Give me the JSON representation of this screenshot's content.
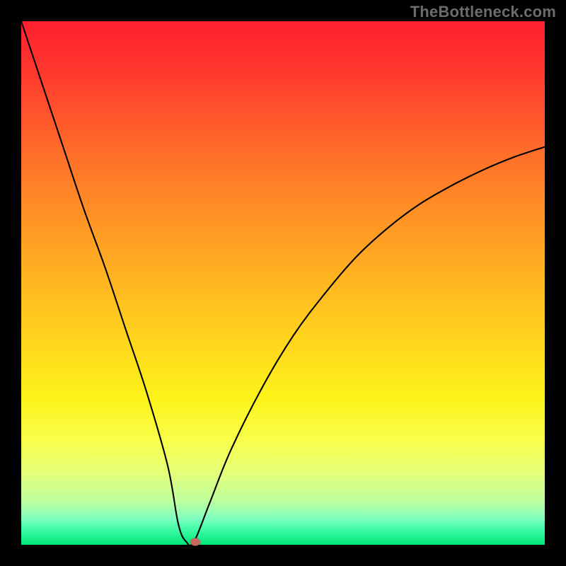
{
  "watermark": "TheBottleneck.com",
  "colors": {
    "frame_bg": "#000000",
    "curve_stroke": "#000000",
    "marker_fill": "#cb675f",
    "gradient_stops": [
      "#ff1f2f",
      "#ff3a2d",
      "#ff6a2a",
      "#ff8f26",
      "#ffb621",
      "#ffd81c",
      "#fcf31a",
      "#f8ff4a",
      "#e6ff78",
      "#baffa0",
      "#7effc0",
      "#35f9a0",
      "#00e676"
    ]
  },
  "chart_data": {
    "type": "line",
    "title": "",
    "xlabel": "",
    "ylabel": "",
    "xlim": [
      0,
      100
    ],
    "ylim": [
      0,
      100
    ],
    "grid": false,
    "legend": false,
    "series": [
      {
        "name": "bottleneck-curve",
        "x": [
          0,
          4,
          8,
          12,
          16,
          20,
          24,
          28,
          30,
          31.5,
          33,
          36,
          40,
          46,
          52,
          58,
          64,
          70,
          76,
          82,
          88,
          94,
          100
        ],
        "y": [
          100,
          88,
          76,
          64,
          53,
          41,
          29,
          15,
          4,
          0.6,
          0.6,
          8,
          18,
          30,
          40,
          48,
          55,
          60.5,
          65,
          68.5,
          71.5,
          74,
          76
        ]
      }
    ],
    "marker": {
      "x": 33.2,
      "y": 0.6
    },
    "notes": "Values are read off a normalized 0–100 plot area (no visible axis ticks). x=0 is left edge of colored area, y=100 is top edge. Curve has a sharp minimum near x≈32, touching y≈0.6, then rises with decreasing slope toward y≈76 at the right edge."
  }
}
